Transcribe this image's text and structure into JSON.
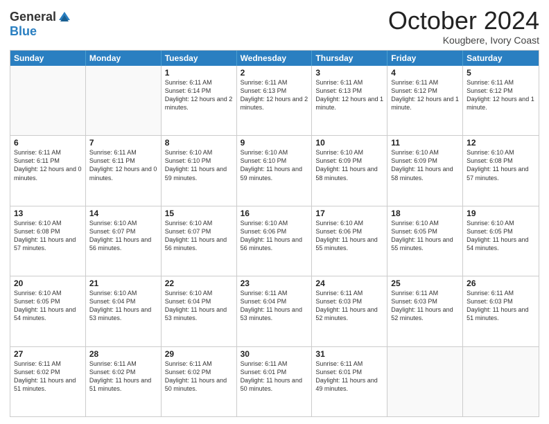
{
  "logo": {
    "general": "General",
    "blue": "Blue"
  },
  "title": "October 2024",
  "location": "Kougbere, Ivory Coast",
  "header_days": [
    "Sunday",
    "Monday",
    "Tuesday",
    "Wednesday",
    "Thursday",
    "Friday",
    "Saturday"
  ],
  "weeks": [
    [
      {
        "day": "",
        "info": ""
      },
      {
        "day": "",
        "info": ""
      },
      {
        "day": "1",
        "info": "Sunrise: 6:11 AM\nSunset: 6:14 PM\nDaylight: 12 hours and 2 minutes."
      },
      {
        "day": "2",
        "info": "Sunrise: 6:11 AM\nSunset: 6:13 PM\nDaylight: 12 hours and 2 minutes."
      },
      {
        "day": "3",
        "info": "Sunrise: 6:11 AM\nSunset: 6:13 PM\nDaylight: 12 hours and 1 minute."
      },
      {
        "day": "4",
        "info": "Sunrise: 6:11 AM\nSunset: 6:12 PM\nDaylight: 12 hours and 1 minute."
      },
      {
        "day": "5",
        "info": "Sunrise: 6:11 AM\nSunset: 6:12 PM\nDaylight: 12 hours and 1 minute."
      }
    ],
    [
      {
        "day": "6",
        "info": "Sunrise: 6:11 AM\nSunset: 6:11 PM\nDaylight: 12 hours and 0 minutes."
      },
      {
        "day": "7",
        "info": "Sunrise: 6:11 AM\nSunset: 6:11 PM\nDaylight: 12 hours and 0 minutes."
      },
      {
        "day": "8",
        "info": "Sunrise: 6:10 AM\nSunset: 6:10 PM\nDaylight: 11 hours and 59 minutes."
      },
      {
        "day": "9",
        "info": "Sunrise: 6:10 AM\nSunset: 6:10 PM\nDaylight: 11 hours and 59 minutes."
      },
      {
        "day": "10",
        "info": "Sunrise: 6:10 AM\nSunset: 6:09 PM\nDaylight: 11 hours and 58 minutes."
      },
      {
        "day": "11",
        "info": "Sunrise: 6:10 AM\nSunset: 6:09 PM\nDaylight: 11 hours and 58 minutes."
      },
      {
        "day": "12",
        "info": "Sunrise: 6:10 AM\nSunset: 6:08 PM\nDaylight: 11 hours and 57 minutes."
      }
    ],
    [
      {
        "day": "13",
        "info": "Sunrise: 6:10 AM\nSunset: 6:08 PM\nDaylight: 11 hours and 57 minutes."
      },
      {
        "day": "14",
        "info": "Sunrise: 6:10 AM\nSunset: 6:07 PM\nDaylight: 11 hours and 56 minutes."
      },
      {
        "day": "15",
        "info": "Sunrise: 6:10 AM\nSunset: 6:07 PM\nDaylight: 11 hours and 56 minutes."
      },
      {
        "day": "16",
        "info": "Sunrise: 6:10 AM\nSunset: 6:06 PM\nDaylight: 11 hours and 56 minutes."
      },
      {
        "day": "17",
        "info": "Sunrise: 6:10 AM\nSunset: 6:06 PM\nDaylight: 11 hours and 55 minutes."
      },
      {
        "day": "18",
        "info": "Sunrise: 6:10 AM\nSunset: 6:05 PM\nDaylight: 11 hours and 55 minutes."
      },
      {
        "day": "19",
        "info": "Sunrise: 6:10 AM\nSunset: 6:05 PM\nDaylight: 11 hours and 54 minutes."
      }
    ],
    [
      {
        "day": "20",
        "info": "Sunrise: 6:10 AM\nSunset: 6:05 PM\nDaylight: 11 hours and 54 minutes."
      },
      {
        "day": "21",
        "info": "Sunrise: 6:10 AM\nSunset: 6:04 PM\nDaylight: 11 hours and 53 minutes."
      },
      {
        "day": "22",
        "info": "Sunrise: 6:10 AM\nSunset: 6:04 PM\nDaylight: 11 hours and 53 minutes."
      },
      {
        "day": "23",
        "info": "Sunrise: 6:11 AM\nSunset: 6:04 PM\nDaylight: 11 hours and 53 minutes."
      },
      {
        "day": "24",
        "info": "Sunrise: 6:11 AM\nSunset: 6:03 PM\nDaylight: 11 hours and 52 minutes."
      },
      {
        "day": "25",
        "info": "Sunrise: 6:11 AM\nSunset: 6:03 PM\nDaylight: 11 hours and 52 minutes."
      },
      {
        "day": "26",
        "info": "Sunrise: 6:11 AM\nSunset: 6:03 PM\nDaylight: 11 hours and 51 minutes."
      }
    ],
    [
      {
        "day": "27",
        "info": "Sunrise: 6:11 AM\nSunset: 6:02 PM\nDaylight: 11 hours and 51 minutes."
      },
      {
        "day": "28",
        "info": "Sunrise: 6:11 AM\nSunset: 6:02 PM\nDaylight: 11 hours and 51 minutes."
      },
      {
        "day": "29",
        "info": "Sunrise: 6:11 AM\nSunset: 6:02 PM\nDaylight: 11 hours and 50 minutes."
      },
      {
        "day": "30",
        "info": "Sunrise: 6:11 AM\nSunset: 6:01 PM\nDaylight: 11 hours and 50 minutes."
      },
      {
        "day": "31",
        "info": "Sunrise: 6:11 AM\nSunset: 6:01 PM\nDaylight: 11 hours and 49 minutes."
      },
      {
        "day": "",
        "info": ""
      },
      {
        "day": "",
        "info": ""
      }
    ]
  ]
}
